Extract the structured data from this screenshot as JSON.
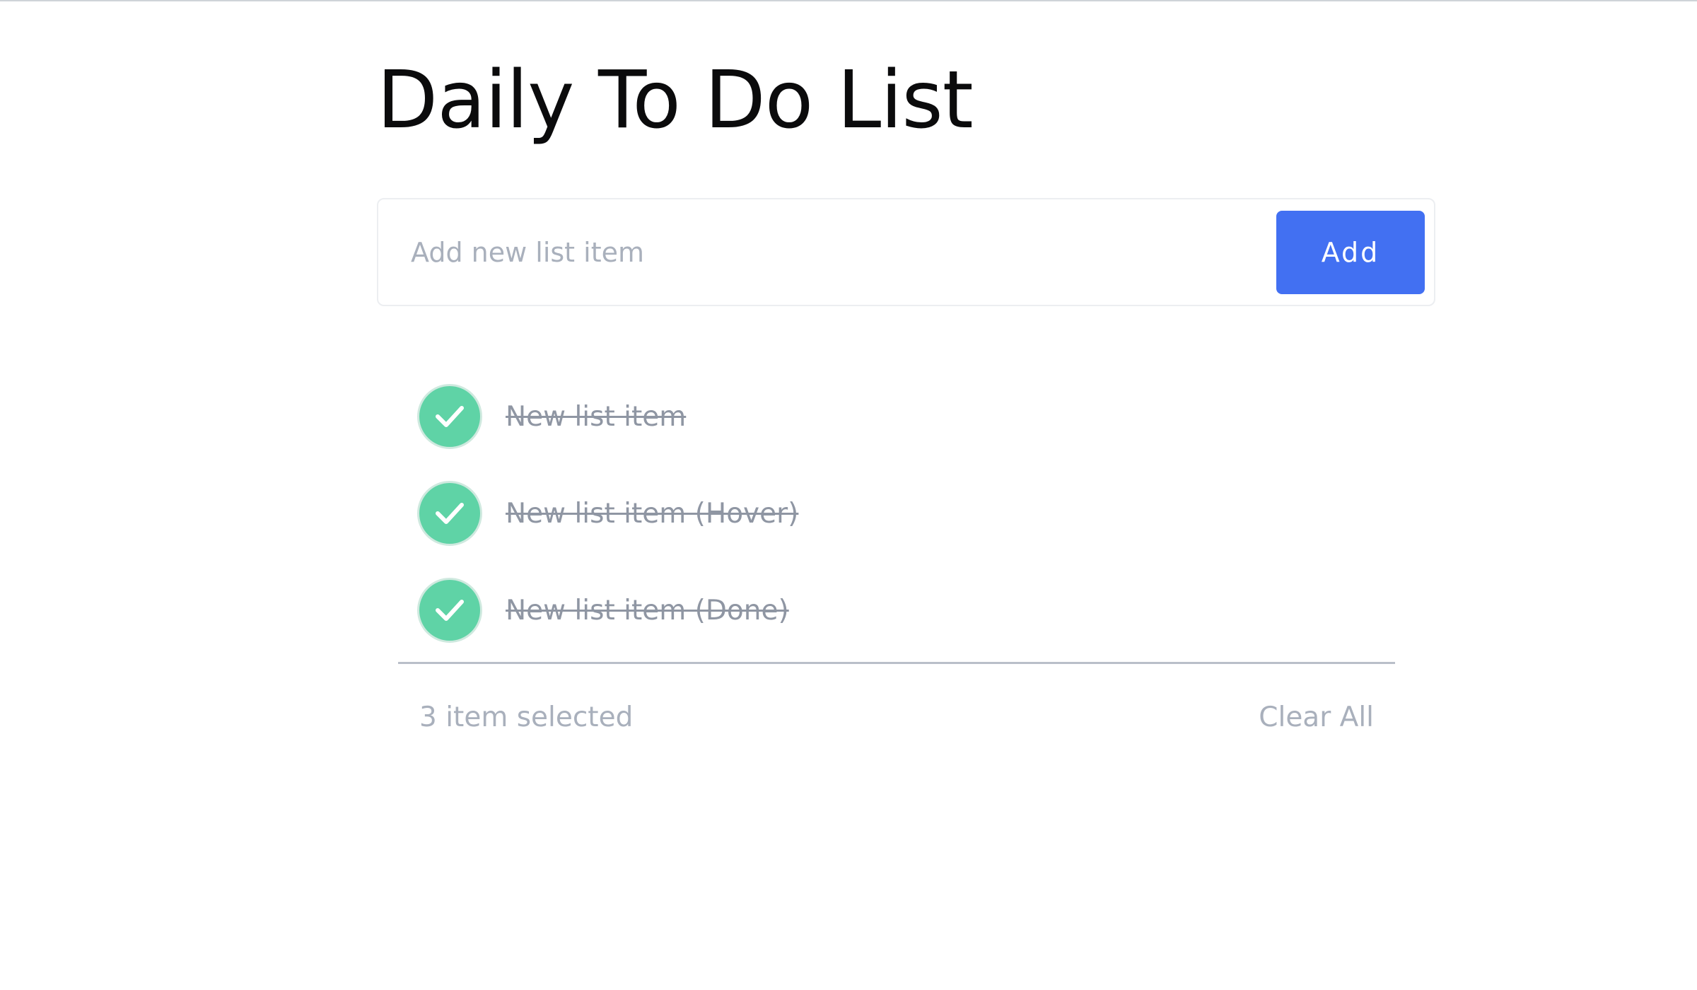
{
  "header": {
    "title": "Daily To Do List"
  },
  "input": {
    "value": "",
    "placeholder": "Add new list item",
    "add_label": "Add"
  },
  "items": [
    {
      "label": "New list item",
      "done": true
    },
    {
      "label": "New list item (Hover)",
      "done": true
    },
    {
      "label": "New list item (Done)",
      "done": true
    }
  ],
  "footer": {
    "count_text": "3 item selected",
    "clear_label": "Clear All"
  },
  "colors": {
    "accent": "#4270f2",
    "check_bg": "#5fd3a6",
    "muted_text": "#a9b0bc",
    "done_text": "#8f96a3"
  },
  "icons": {
    "check": "checkmark-icon"
  }
}
